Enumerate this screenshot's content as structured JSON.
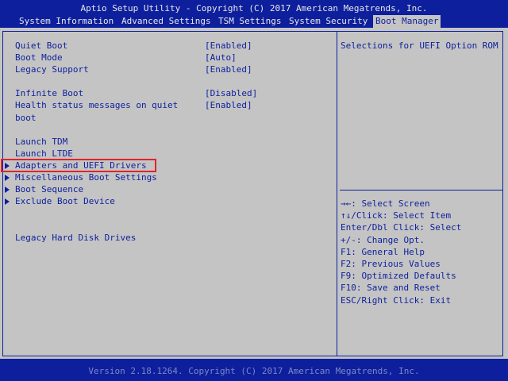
{
  "header": {
    "title": "Aptio Setup Utility - Copyright (C) 2017 American Megatrends, Inc.",
    "tabs": [
      {
        "label": "System Information"
      },
      {
        "label": "Advanced Settings"
      },
      {
        "label": "TSM Settings"
      },
      {
        "label": "System Security"
      },
      {
        "label": "Boot Manager",
        "active": true
      }
    ]
  },
  "menu": {
    "quiet_boot": {
      "label": "Quiet Boot",
      "value": "[Enabled]"
    },
    "boot_mode": {
      "label": "Boot Mode",
      "value": "[Auto]"
    },
    "legacy_support": {
      "label": "Legacy Support",
      "value": "[Enabled]"
    },
    "infinite_boot": {
      "label": "Infinite Boot",
      "value": "[Disabled]"
    },
    "health_status": {
      "label_line1": "Health status messages on quiet",
      "label_line2": "boot",
      "value": "[Enabled]"
    },
    "launch_tdm": {
      "label": "Launch TDM"
    },
    "launch_ltde": {
      "label": "Launch LTDE"
    },
    "adapters_uefi": {
      "label": "Adapters and UEFI Drivers"
    },
    "misc_boot": {
      "label": "Miscellaneous Boot Settings"
    },
    "boot_sequence": {
      "label": "Boot Sequence"
    },
    "exclude_boot": {
      "label": "Exclude Boot Device"
    },
    "legacy_hdd": {
      "label": "Legacy Hard Disk Drives"
    }
  },
  "help": {
    "description": "Selections for UEFI Option ROM",
    "keys": [
      "→←: Select Screen",
      "↑↓/Click: Select Item",
      "Enter/Dbl Click: Select",
      "+/-: Change Opt.",
      "F1: General Help",
      "F2: Previous Values",
      "F9: Optimized Defaults",
      "F10: Save and Reset",
      "ESC/Right Click: Exit"
    ]
  },
  "footer": {
    "text": "Version 2.18.1264. Copyright (C) 2017 American Megatrends, Inc."
  },
  "colors": {
    "primary_blue": "#0d1f9c",
    "background_gray": "#c4c4c4",
    "highlight_red": "#e0242a"
  }
}
